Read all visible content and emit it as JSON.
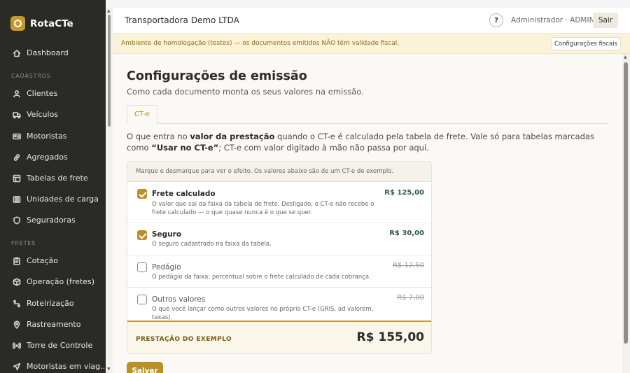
{
  "app": {
    "name": "RotaCTe"
  },
  "sidebar": {
    "items": [
      {
        "label": "Dashboard",
        "icon": "home-icon"
      },
      {
        "label": "Clientes",
        "icon": "user-icon"
      },
      {
        "label": "Veículos",
        "icon": "truck-icon"
      },
      {
        "label": "Motoristas",
        "icon": "id-card-icon"
      },
      {
        "label": "Agregados",
        "icon": "link-icon"
      },
      {
        "label": "Tabelas de frete",
        "icon": "table-icon"
      },
      {
        "label": "Unidades de carga",
        "icon": "container-icon"
      },
      {
        "label": "Seguradoras",
        "icon": "shield-icon"
      },
      {
        "label": "Cotação",
        "icon": "clipboard-icon"
      },
      {
        "label": "Operação (fretes)",
        "icon": "box-icon"
      },
      {
        "label": "Roteirização",
        "icon": "route-icon"
      },
      {
        "label": "Rastreamento",
        "icon": "pin-icon"
      },
      {
        "label": "Torre de Controle",
        "icon": "broadcast-icon"
      },
      {
        "label": "Motoristas em viag...",
        "icon": "navigation-icon"
      }
    ],
    "sections": {
      "cadastros": "CADASTROS",
      "fretes": "FRETES"
    }
  },
  "header": {
    "company": "Transportadora Demo LTDA",
    "help": "?",
    "user": "Administrador · ADMIN",
    "logout": "Sair"
  },
  "banner": {
    "text": "Ambiente de homologação (testes) — os documentos emitidos NÃO têm validade fiscal.",
    "button": "Configurações fiscais"
  },
  "main": {
    "title": "Configurações de emissão",
    "subtitle": "Como cada documento monta os seus valores na emissão.",
    "tab": "CT-e",
    "desc": {
      "p1": "O que entra no ",
      "b1": "valor da prestação",
      "p2": " quando o CT-e é calculado pela tabela de frete. Vale só para tabelas marcadas como ",
      "b2": "“Usar no CT-e”",
      "p3": "; CT-e com valor digitado à mão não passa por aqui."
    },
    "hint": "Marque e desmarque para ver o efeito. Os valores abaixo são de um CT-e de exemplo.",
    "options": [
      {
        "title": "Frete calculado",
        "desc": "O valor que sai da faixa da tabela de frete. Desligado, o CT-e não recebe o frete calculado — o que quase nunca é o que se quer.",
        "value": "R$ 125,00",
        "checked": true
      },
      {
        "title": "Seguro",
        "desc": "O seguro cadastrado na faixa da tabela.",
        "value": "R$ 30,00",
        "checked": true
      },
      {
        "title": "Pedágio",
        "desc": "O pedágio da faixa: percentual sobre o frete calculado de cada cobrança.",
        "value": "R$ 12,50",
        "checked": false
      },
      {
        "title": "Outros valores",
        "desc": "O que você lançar como outros valores no próprio CT-e (GRIS, ad valorem, taxas).",
        "value": "R$ 7,00",
        "checked": false
      }
    ],
    "total": {
      "label": "PRESTAÇÃO DO EXEMPLO",
      "value": "R$ 155,00"
    },
    "save": "Salvar"
  }
}
